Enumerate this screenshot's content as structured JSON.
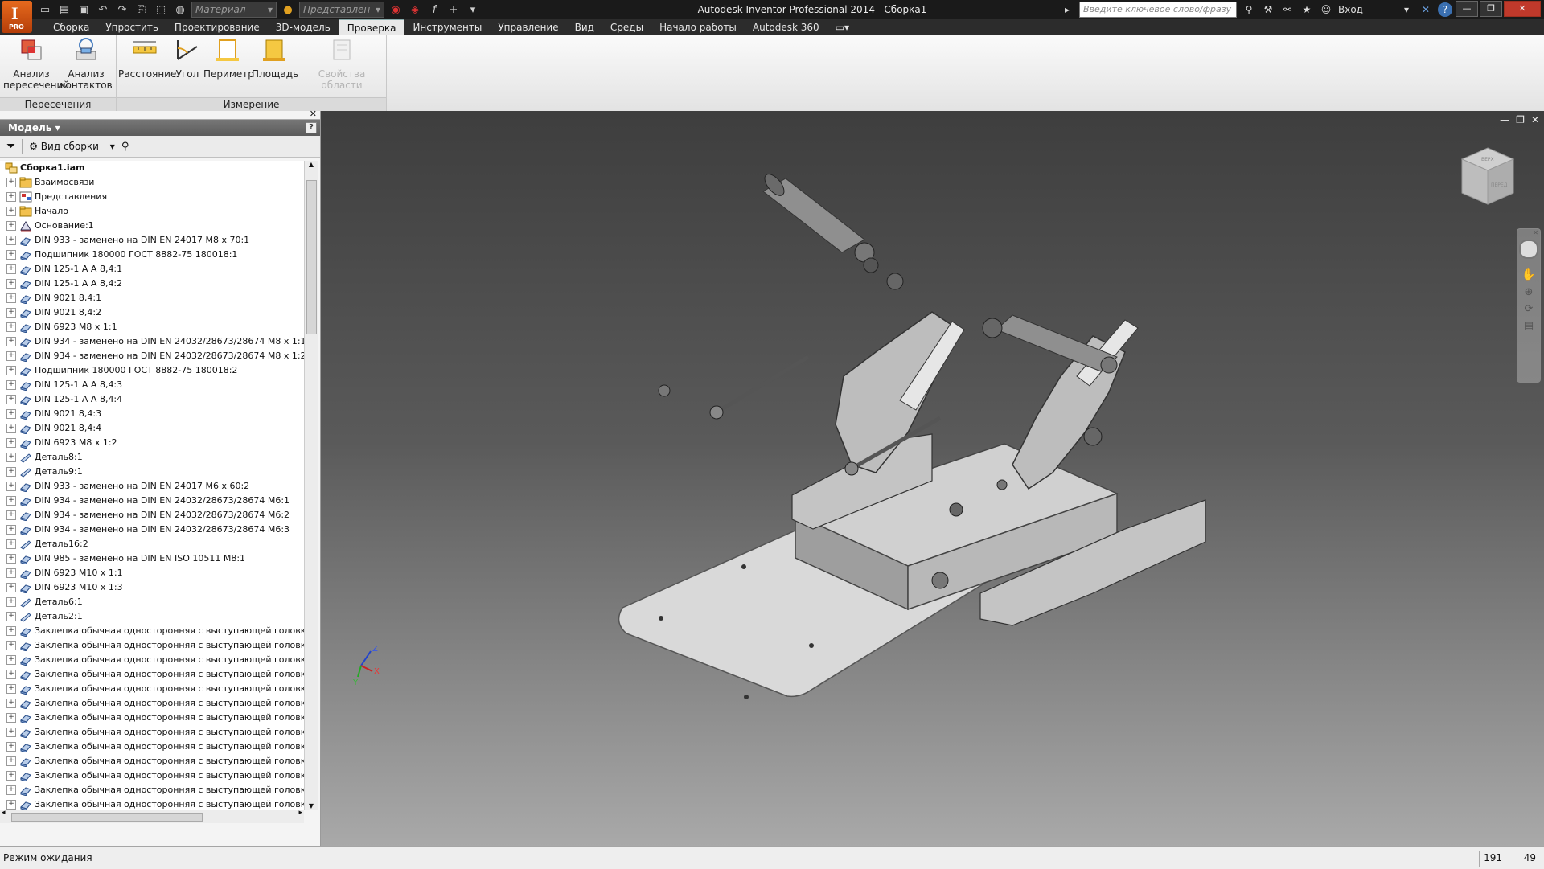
{
  "titlebar": {
    "title": "Autodesk Inventor Professional 2014",
    "document": "Сборка1",
    "app_badge": "PRO",
    "material_combo": "Материал",
    "view_rep_combo": "Представлен",
    "search_placeholder": "Введите ключевое слово/фразу",
    "signin": "Вход"
  },
  "ribbon": {
    "tabs": [
      "Сборка",
      "Упростить",
      "Проектирование",
      "3D-модель",
      "Проверка",
      "Инструменты",
      "Управление",
      "Вид",
      "Среды",
      "Начало работы",
      "Autodesk 360"
    ],
    "active_tab": "Проверка",
    "panels": [
      {
        "title": "Пересечения",
        "buttons": [
          "Анализ пересечений",
          "Анализ контактов"
        ]
      },
      {
        "title": "Измерение",
        "buttons": [
          "Расстояние",
          "Угол",
          "Периметр",
          "Площадь",
          "Свойства области"
        ]
      }
    ],
    "btn_interference": [
      "Анализ",
      "пересечений"
    ],
    "btn_contact": [
      "Анализ",
      "контактов"
    ],
    "btn_distance": "Расстояние",
    "btn_angle": "Угол",
    "btn_loop": "Периметр",
    "btn_area": "Площадь",
    "btn_region": "Свойства области",
    "panel_interference": "Пересечения",
    "panel_measure": "Измерение"
  },
  "browser": {
    "title": "Модель",
    "view_mode": "Вид сборки",
    "help": "?",
    "root": "Сборка1.iam",
    "items": [
      {
        "label": "Взаимосвязи",
        "icon": "folder-icon"
      },
      {
        "label": "Представления",
        "icon": "representations-icon"
      },
      {
        "label": "Начало",
        "icon": "folder-icon"
      },
      {
        "label": "Основание:1",
        "icon": "grounded-part-icon"
      },
      {
        "label": "DIN 933 - заменено на DIN EN 24017 M8  x 70:1",
        "icon": "part-icon"
      },
      {
        "label": "Подшипник 180000 ГОСТ 8882-75 180018:1",
        "icon": "part-icon"
      },
      {
        "label": "DIN 125-1 A A 8,4:1",
        "icon": "part-icon"
      },
      {
        "label": "DIN 125-1 A A 8,4:2",
        "icon": "part-icon"
      },
      {
        "label": "DIN 9021 8,4:1",
        "icon": "part-icon"
      },
      {
        "label": "DIN 9021 8,4:2",
        "icon": "part-icon"
      },
      {
        "label": "DIN 6923 M8 x 1:1",
        "icon": "part-icon"
      },
      {
        "label": "DIN 934 - заменено на DIN EN 24032/28673/28674 M8 x 1:1",
        "icon": "part-icon"
      },
      {
        "label": "DIN 934 - заменено на DIN EN 24032/28673/28674 M8 x 1:2",
        "icon": "part-icon"
      },
      {
        "label": "Подшипник 180000 ГОСТ 8882-75 180018:2",
        "icon": "part-icon"
      },
      {
        "label": "DIN 125-1 A A 8,4:3",
        "icon": "part-icon"
      },
      {
        "label": "DIN 125-1 A A 8,4:4",
        "icon": "part-icon"
      },
      {
        "label": "DIN 9021 8,4:3",
        "icon": "part-icon"
      },
      {
        "label": "DIN 9021 8,4:4",
        "icon": "part-icon"
      },
      {
        "label": "DIN 6923 M8 x 1:2",
        "icon": "part-icon"
      },
      {
        "label": "Деталь8:1",
        "icon": "sheetmetal-icon"
      },
      {
        "label": "Деталь9:1",
        "icon": "sheetmetal-icon"
      },
      {
        "label": "DIN 933 - заменено на DIN EN 24017 M6  x 60:2",
        "icon": "part-icon"
      },
      {
        "label": "DIN 934 - заменено на DIN EN 24032/28673/28674 M6:1",
        "icon": "part-icon"
      },
      {
        "label": "DIN 934 - заменено на DIN EN 24032/28673/28674 M6:2",
        "icon": "part-icon"
      },
      {
        "label": "DIN 934 - заменено на DIN EN 24032/28673/28674 M6:3",
        "icon": "part-icon"
      },
      {
        "label": "Деталь16:2",
        "icon": "sheetmetal-icon"
      },
      {
        "label": "DIN 985 - заменено на DIN EN ISO 10511 M8:1",
        "icon": "part-icon"
      },
      {
        "label": "DIN 6923 M10 x 1:1",
        "icon": "part-icon"
      },
      {
        "label": "DIN 6923 M10 x 1:3",
        "icon": "part-icon"
      },
      {
        "label": "Деталь6:1",
        "icon": "sheetmetal-icon"
      },
      {
        "label": "Деталь2:1",
        "icon": "sheetmetal-icon"
      },
      {
        "label": "Заклепка обычная односторонняя с выступающей головкой с от",
        "icon": "part-icon"
      },
      {
        "label": "Заклепка обычная односторонняя с выступающей головкой с от",
        "icon": "part-icon"
      },
      {
        "label": "Заклепка обычная односторонняя с выступающей головкой с от",
        "icon": "part-icon"
      },
      {
        "label": "Заклепка обычная односторонняя с выступающей головкой с от",
        "icon": "part-icon"
      },
      {
        "label": "Заклепка обычная односторонняя с выступающей головкой с от",
        "icon": "part-icon"
      },
      {
        "label": "Заклепка обычная односторонняя с выступающей головкой с от",
        "icon": "part-icon"
      },
      {
        "label": "Заклепка обычная односторонняя с выступающей головкой с от",
        "icon": "part-icon"
      },
      {
        "label": "Заклепка обычная односторонняя с выступающей головкой с от",
        "icon": "part-icon"
      },
      {
        "label": "Заклепка обычная односторонняя с выступающей головкой с от",
        "icon": "part-icon"
      },
      {
        "label": "Заклепка обычная односторонняя с выступающей головкой с от",
        "icon": "part-icon"
      },
      {
        "label": "Заклепка обычная односторонняя с выступающей головкой с от",
        "icon": "part-icon"
      },
      {
        "label": "Заклепка обычная односторонняя с выступающей головкой с от",
        "icon": "part-icon"
      },
      {
        "label": "Заклепка обычная односторонняя с выступающей головкой с от",
        "icon": "part-icon"
      },
      {
        "label": "Заклепка обычная односторонняя с выступающей головкой с от",
        "icon": "part-icon"
      }
    ]
  },
  "viewcube": {
    "face_front": "ПЕРЕД",
    "face_top": "ВЕРХ"
  },
  "triad": {
    "x": "X",
    "y": "Y",
    "z": "Z"
  },
  "status": {
    "message": "Режим ожидания",
    "count1": "191",
    "count2": "49"
  },
  "colors": {
    "accent": "#e66a1e",
    "active_tab": "#e8e8e8",
    "viewport_top": "#3e3e3e",
    "viewport_bottom": "#a9a9a9"
  }
}
